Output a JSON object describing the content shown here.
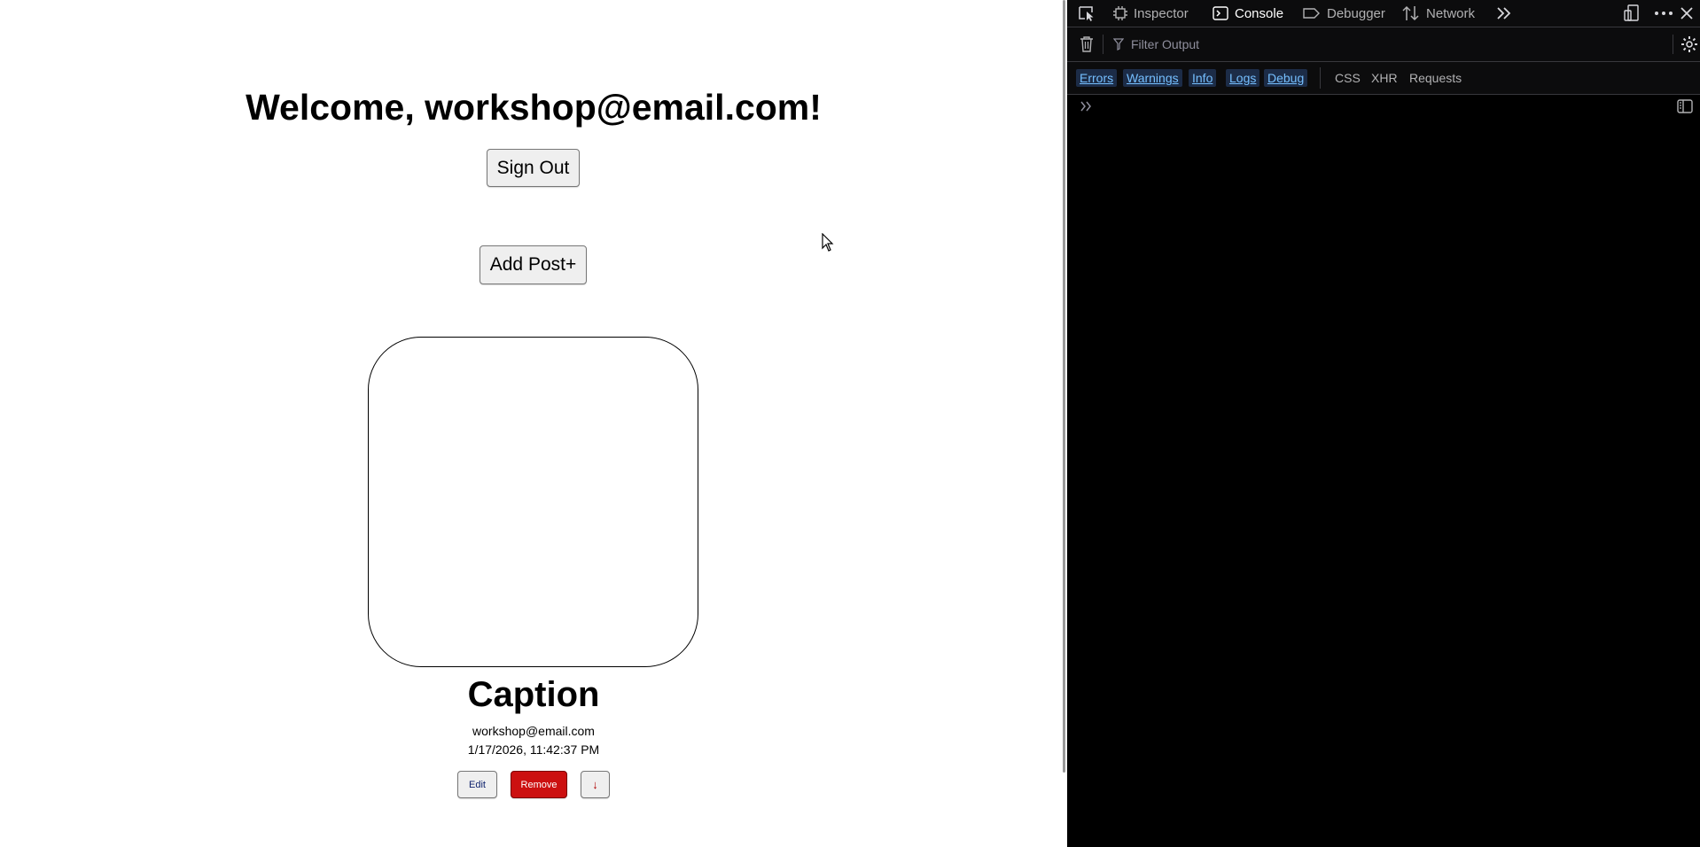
{
  "page": {
    "welcome": "Welcome, workshop@email.com!",
    "sign_out_label": "Sign Out",
    "add_post_label": "Add Post+",
    "post": {
      "caption": "Caption",
      "author": "workshop@email.com",
      "timestamp": "1/17/2026, 11:42:37 PM",
      "edit_label": "Edit",
      "remove_label": "Remove",
      "download_label": "↓"
    }
  },
  "devtools": {
    "tabs": [
      "Inspector",
      "Console",
      "Debugger",
      "Network"
    ],
    "active_tab": "Console",
    "filter_placeholder": "Filter Output",
    "levels": [
      "Errors",
      "Warnings",
      "Info",
      "Logs",
      "Debug"
    ],
    "extra_filters": [
      "CSS",
      "XHR",
      "Requests"
    ]
  },
  "colors": {
    "remove_button": "#cc1010",
    "devtools_bg": "#000000",
    "level_active": "#75bfff"
  }
}
